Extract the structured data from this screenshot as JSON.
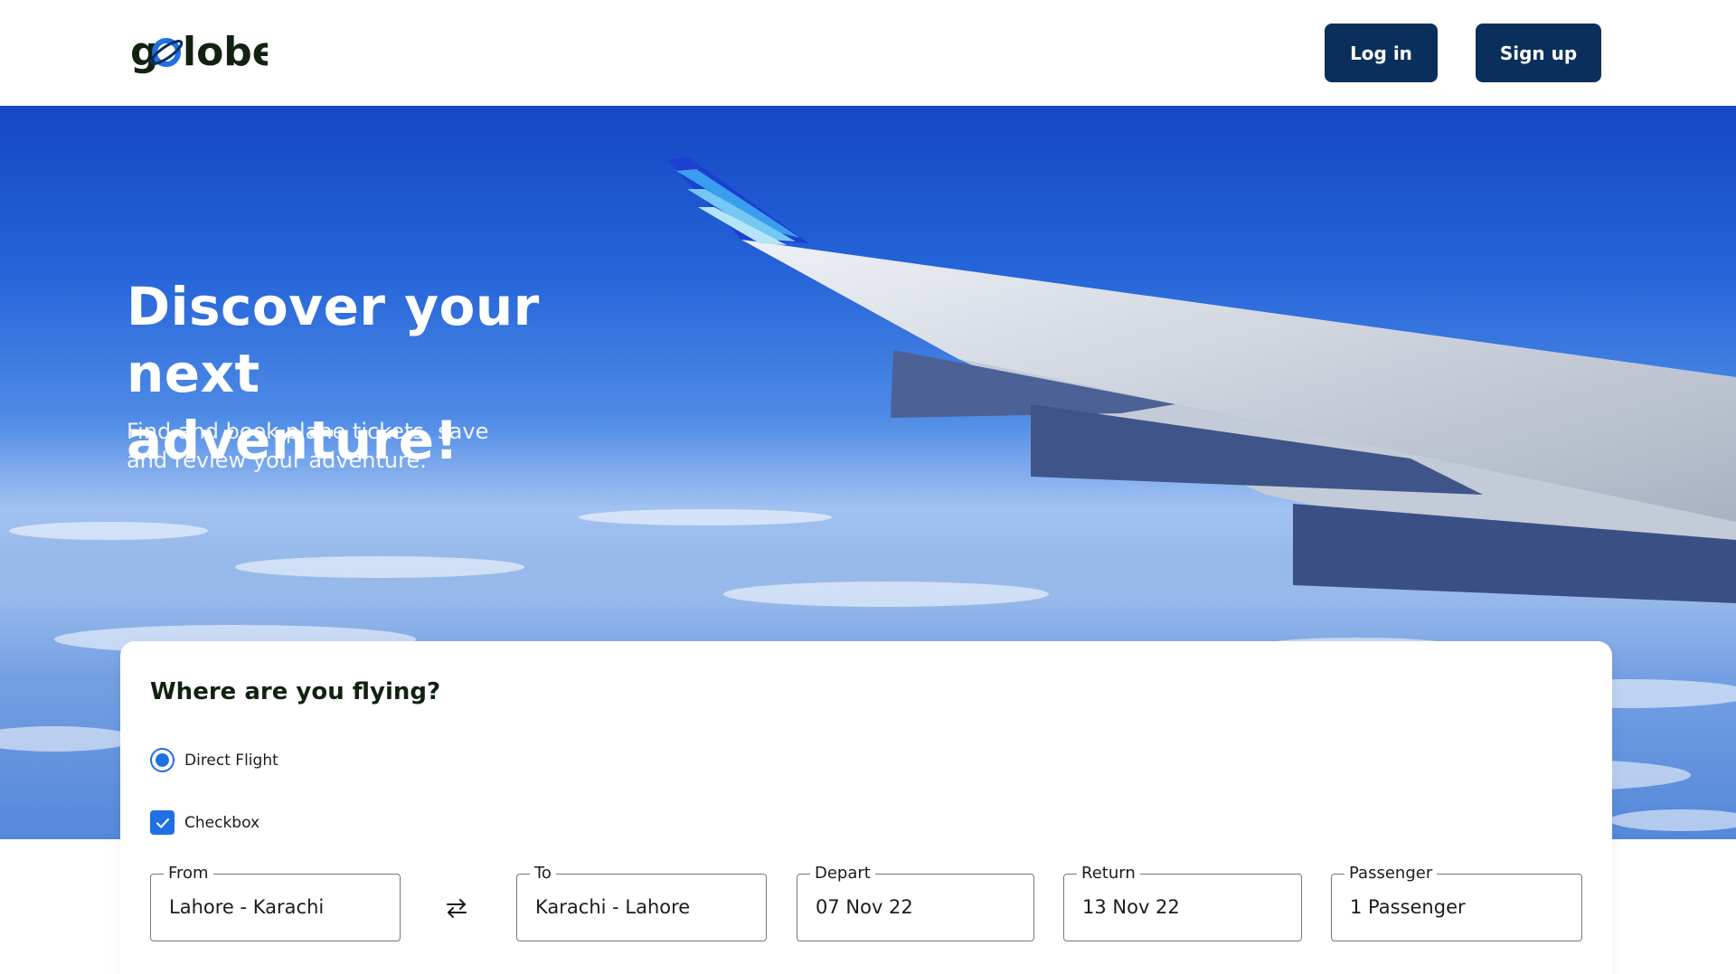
{
  "header": {
    "logo_text": "golobe",
    "login_label": "Log in",
    "signup_label": "Sign up"
  },
  "hero": {
    "title_line1": "Discover your next",
    "title_line2": "adventure!",
    "subtitle_line1": "Find and book plane tickets, save",
    "subtitle_line2": "and review  your adventure."
  },
  "search": {
    "title": "Where are you flying?",
    "direct_flight_label": "Direct Flight",
    "direct_flight_selected": true,
    "checkbox_label": "Checkbox",
    "checkbox_checked": true,
    "fields": {
      "from": {
        "label": "From",
        "value": "Lahore - Karachi"
      },
      "to": {
        "label": "To",
        "value": "Karachi - Lahore"
      },
      "depart": {
        "label": "Depart",
        "value": "07 Nov 22"
      },
      "return": {
        "label": "Return",
        "value": "13 Nov 22"
      },
      "passenger": {
        "label": "Passenger",
        "value": "1 Passenger"
      }
    },
    "swap_icon": "swap-arrows-icon"
  },
  "colors": {
    "button_bg": "#0a2f5c",
    "accent": "#1f6fe5",
    "text": "#112211"
  }
}
